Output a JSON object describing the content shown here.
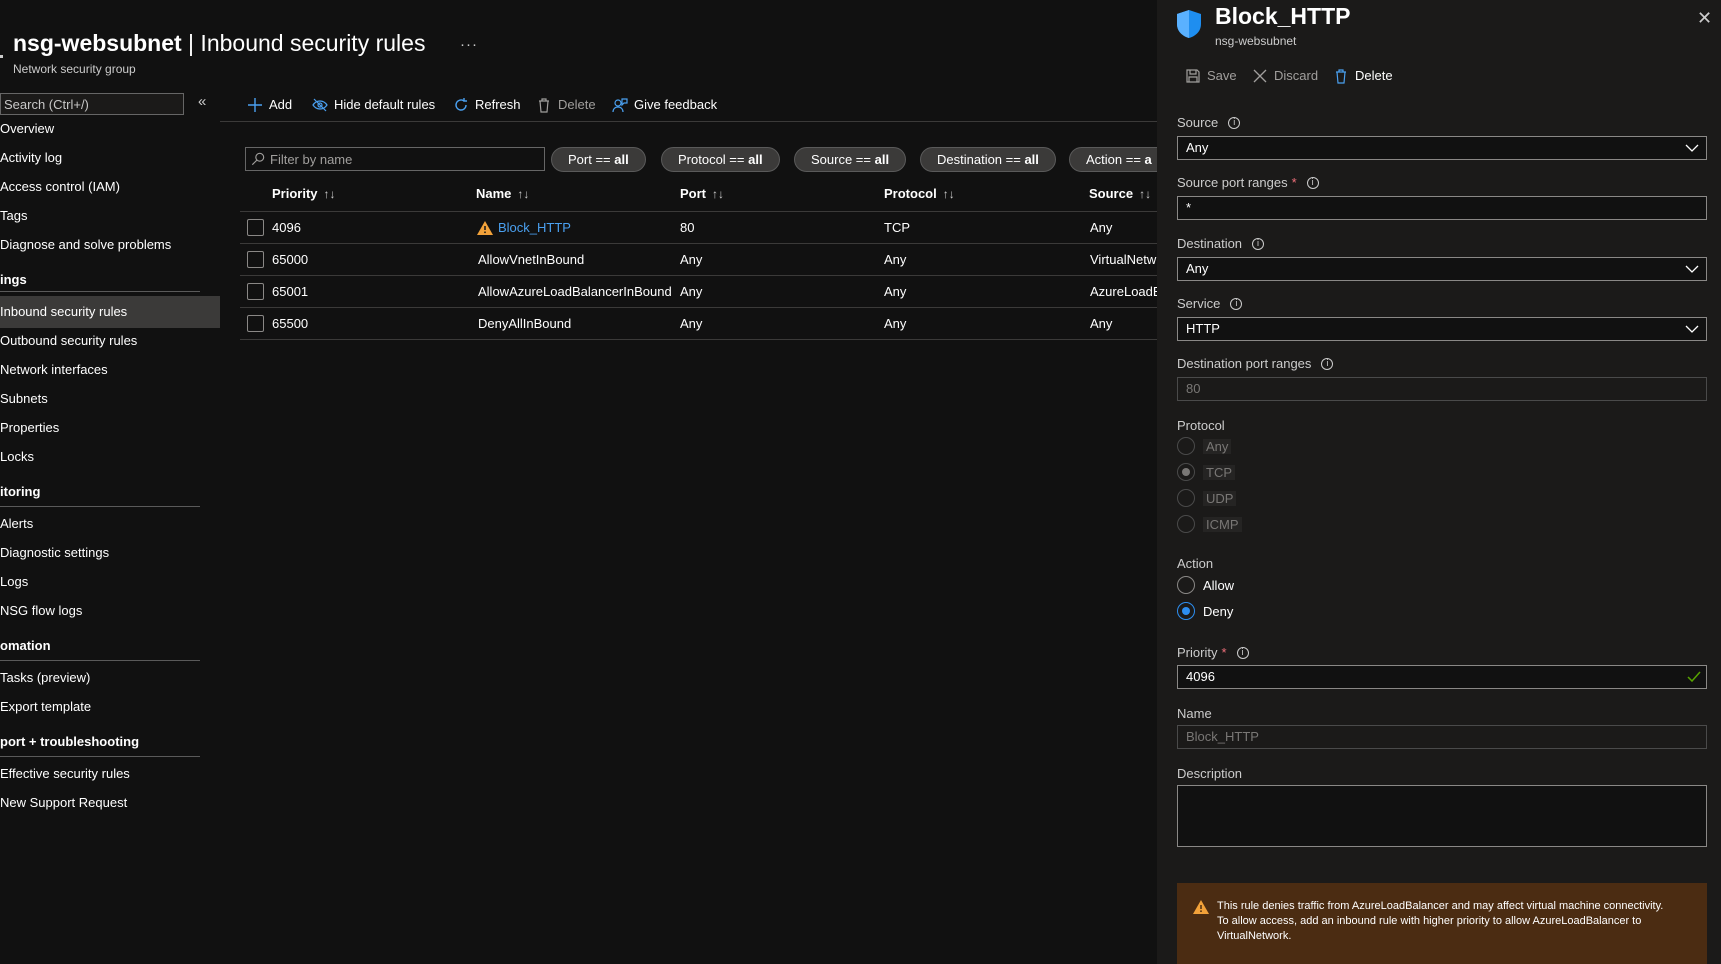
{
  "header": {
    "title_bold": "nsg-websubnet",
    "title_rest": " | Inbound security rules",
    "more": "···",
    "subtitle": "Network security group"
  },
  "nav": {
    "search_placeholder": "Search (Ctrl+/)",
    "collapse": "«",
    "items": [
      "Overview",
      "Activity log",
      "Access control (IAM)",
      "Tags",
      "Diagnose and solve problems",
      "Inbound security rules",
      "Outbound security rules",
      "Network interfaces",
      "Subnets",
      "Properties",
      "Locks",
      "Alerts",
      "Diagnostic settings",
      "Logs",
      "NSG flow logs",
      "Tasks (preview)",
      "Export template",
      "Effective security rules",
      "New Support Request"
    ],
    "groups": [
      "ings",
      "itoring",
      "omation",
      "port + troubleshooting"
    ]
  },
  "toolbar": {
    "add": "Add",
    "hide_default": "Hide default rules",
    "refresh": "Refresh",
    "delete": "Delete",
    "feedback": "Give feedback"
  },
  "filters": {
    "placeholder": "Filter by name",
    "pills": [
      {
        "key": "Port == ",
        "val": "all"
      },
      {
        "key": "Protocol == ",
        "val": "all"
      },
      {
        "key": "Source == ",
        "val": "all"
      },
      {
        "key": "Destination == ",
        "val": "all"
      },
      {
        "key": "Action == ",
        "val": "a"
      }
    ]
  },
  "table": {
    "columns": [
      "Priority",
      "Name",
      "Port",
      "Protocol",
      "Source"
    ],
    "sort_glyph": "↑↓",
    "rows": [
      {
        "priority": "4096",
        "name": "Block_HTTP",
        "port": "80",
        "protocol": "TCP",
        "source": "Any"
      },
      {
        "priority": "65000",
        "name": "AllowVnetInBound",
        "port": "Any",
        "protocol": "Any",
        "source": "VirtualNetw"
      },
      {
        "priority": "65001",
        "name": "AllowAzureLoadBalancerInBound",
        "port": "Any",
        "protocol": "Any",
        "source": "AzureLoadB"
      },
      {
        "priority": "65500",
        "name": "DenyAllInBound",
        "port": "Any",
        "protocol": "Any",
        "source": "Any"
      }
    ]
  },
  "panel": {
    "title": "Block_HTTP",
    "subtitle": "nsg-websubnet",
    "close": "✕",
    "save": "Save",
    "discard": "Discard",
    "delete": "Delete",
    "source_label": "Source",
    "source_value": "Any",
    "source_ports_label": "Source port ranges",
    "source_ports_value": "*",
    "destination_label": "Destination",
    "destination_value": "Any",
    "service_label": "Service",
    "service_value": "HTTP",
    "dest_ports_label": "Destination port ranges",
    "dest_ports_value": "80",
    "protocol_label": "Protocol",
    "protocol_options": [
      "Any",
      "TCP",
      "UDP",
      "ICMP"
    ],
    "protocol_selected": "TCP",
    "action_label": "Action",
    "action_options": [
      "Allow",
      "Deny"
    ],
    "action_selected": "Deny",
    "priority_label": "Priority",
    "priority_value": "4096",
    "name_label": "Name",
    "name_value": "Block_HTTP",
    "description_label": "Description",
    "required_mark": "*",
    "info_glyph": "i",
    "warning": "This rule denies traffic from AzureLoadBalancer and may affect virtual machine connectivity. To allow access, add an inbound rule with higher priority to allow AzureLoadBalancer to VirtualNetwork."
  },
  "colors": {
    "accent": "#2d8ef0",
    "link": "#4aa0f0",
    "warning_bg": "#4b2c12",
    "warning_icon": "#f2a23a",
    "valid_check": "#57a300"
  }
}
